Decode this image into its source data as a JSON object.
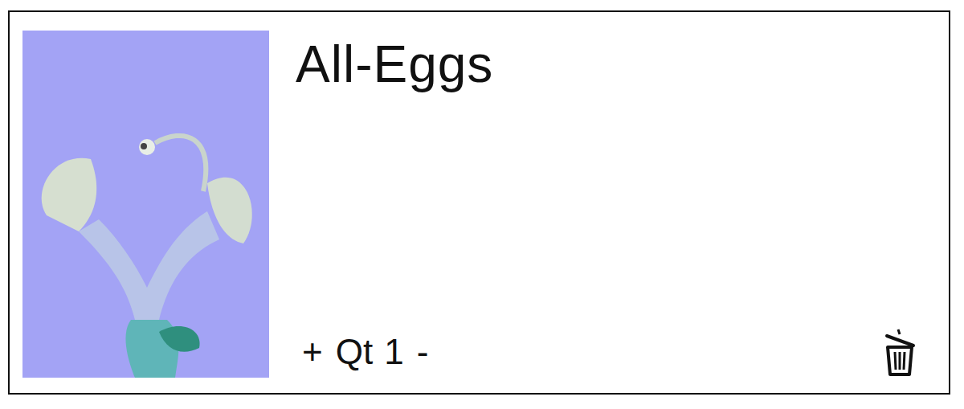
{
  "item": {
    "title": "All-Eggs",
    "quantity": {
      "increase": "+",
      "label": "Qt",
      "value": "1",
      "decrease": "-"
    }
  }
}
